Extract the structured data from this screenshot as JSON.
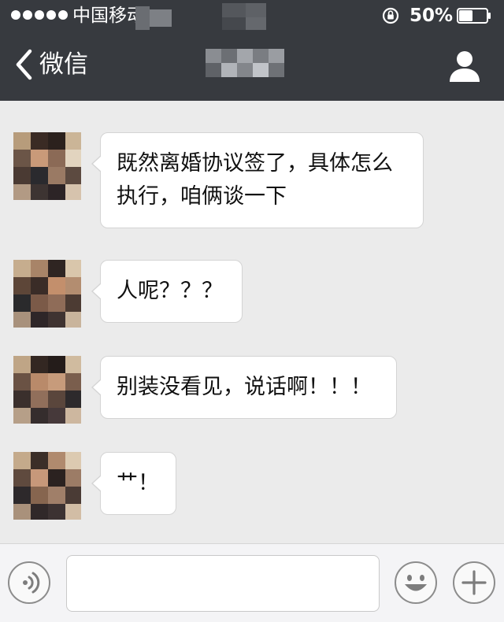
{
  "status_bar": {
    "carrier": "中国移动",
    "battery_percent": "50%",
    "battery_level": 0.5
  },
  "nav": {
    "back_label": "微信"
  },
  "messages": [
    {
      "text_line1": "既然离婚协议签了，具体怎么",
      "text_line2": "执行，咱俩谈一下"
    },
    {
      "text": "人呢？？？"
    },
    {
      "text": "别装没看见，说话啊！！！"
    },
    {
      "text": "艹！"
    }
  ],
  "icons": {
    "back": "chevron-left-icon",
    "profile": "person-icon",
    "voice": "voice-icon",
    "emoji": "smiley-icon",
    "more": "plus-icon",
    "rotation_lock": "rotation-lock-icon",
    "battery": "battery-icon"
  },
  "colors": {
    "header_bg": "#373a3f",
    "chat_bg": "#ebebeb",
    "bubble_bg": "#ffffff",
    "input_bar_bg": "#f4f4f6"
  }
}
